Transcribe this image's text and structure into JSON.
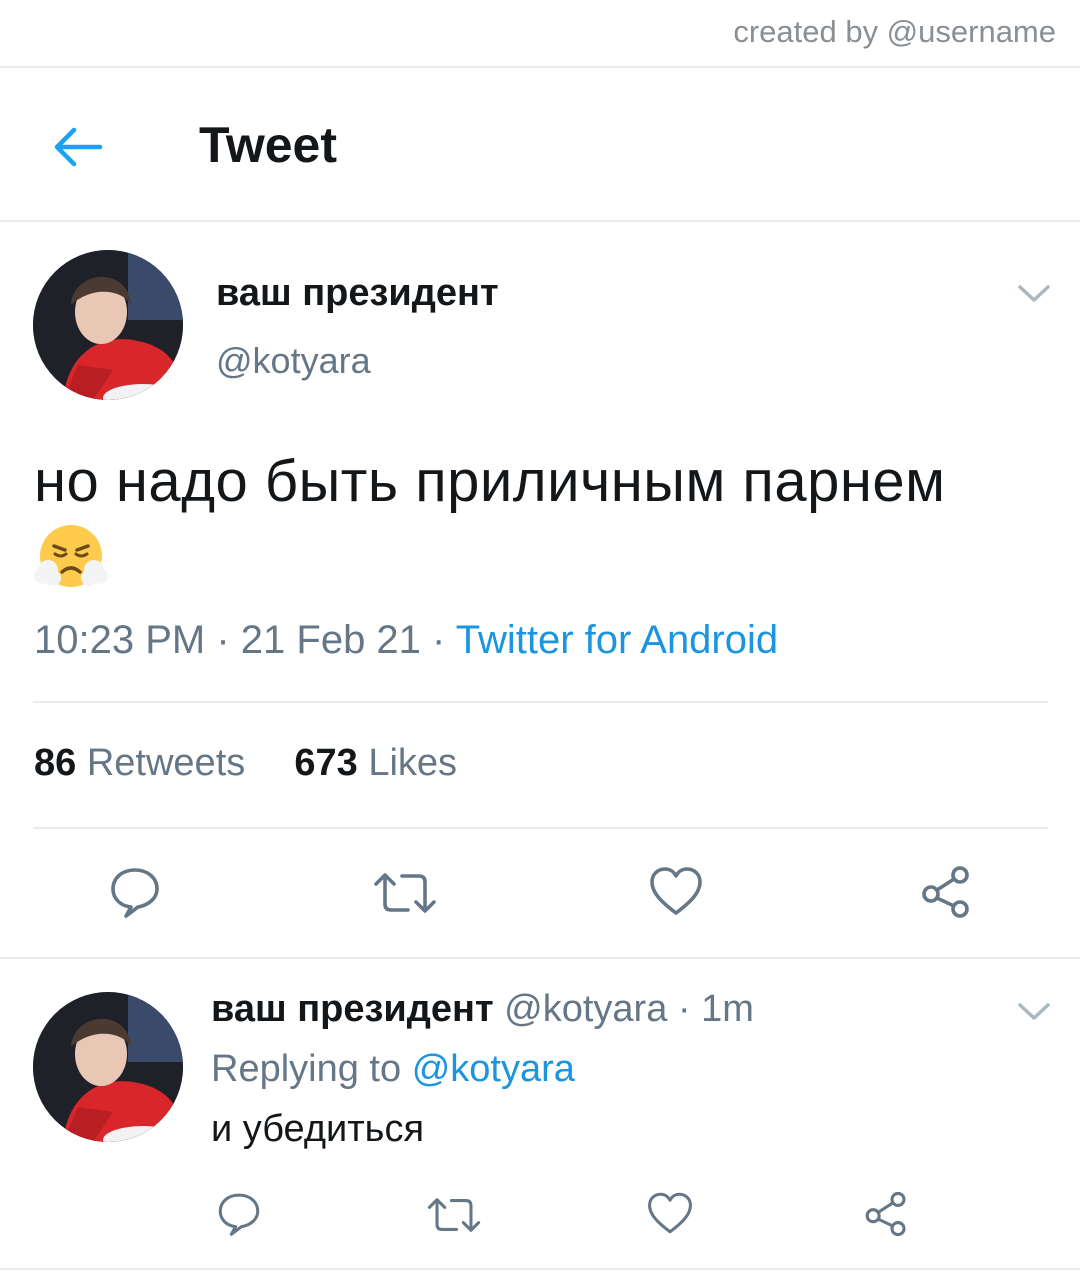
{
  "credit": "created by @username",
  "header": {
    "title": "Tweet"
  },
  "tweet": {
    "display_name": "ваш президент",
    "handle": "@kotyara",
    "text": "но надо быть приличным парнем",
    "emoji": "face-with-steam-from-nose",
    "time": "10:23 PM",
    "date": "21 Feb 21",
    "source": "Twitter for Android",
    "retweets_count": "86",
    "retweets_label": "Retweets",
    "likes_count": "673",
    "likes_label": "Likes"
  },
  "reply": {
    "display_name": "ваш президент",
    "handle": "@kotyara",
    "age": "1m",
    "replying_prefix": "Replying to",
    "replying_to": "@kotyara",
    "text": "и убедиться"
  },
  "colors": {
    "accent": "#1b95e0",
    "secondary_text": "#657786",
    "divider": "#e6ecf0"
  }
}
